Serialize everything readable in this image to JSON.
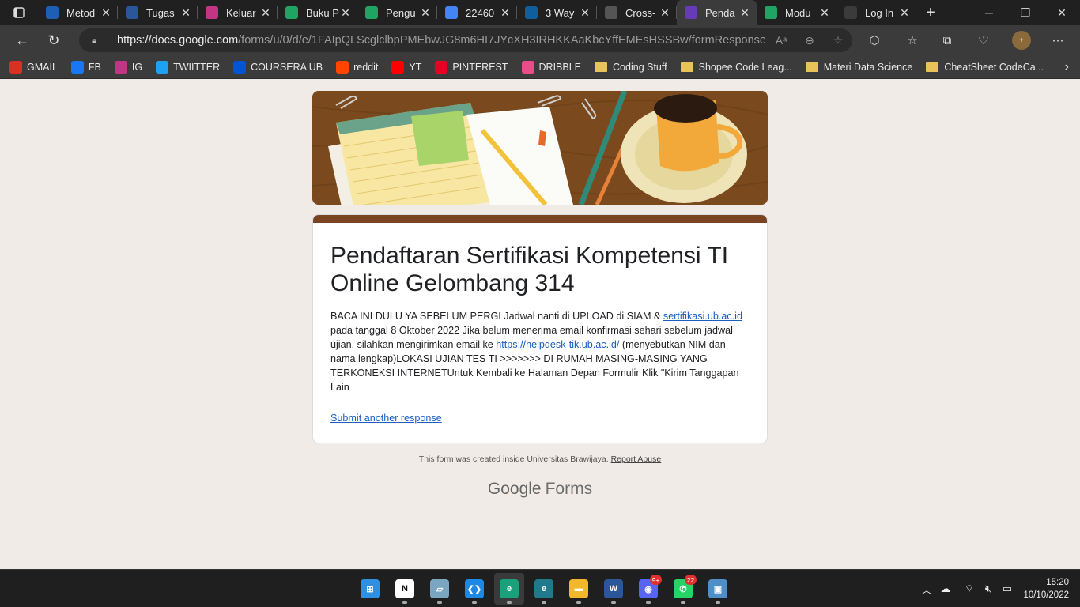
{
  "browser": {
    "tabs": [
      {
        "title": "Metod",
        "icon": "onedrive-icon",
        "color": "#1e5fb4"
      },
      {
        "title": "Tugas",
        "icon": "word-icon",
        "color": "#2b579a"
      },
      {
        "title": "Keluar",
        "icon": "instagram-icon",
        "color": "#c13584"
      },
      {
        "title": "Buku P",
        "icon": "drive-icon",
        "color": "#1fa463"
      },
      {
        "title": "Pengu",
        "icon": "drive-icon",
        "color": "#1fa463"
      },
      {
        "title": "22460",
        "icon": "docs-icon",
        "color": "#4285f4"
      },
      {
        "title": "3 Way",
        "icon": "diamond-icon",
        "color": "#0f5f9e"
      },
      {
        "title": "Cross-",
        "icon": "google-icon",
        "color": "#555555"
      },
      {
        "title": "Penda",
        "icon": "forms-icon",
        "color": "#673ab7",
        "active": true
      },
      {
        "title": "Modu",
        "icon": "drive-icon",
        "color": "#1fa463"
      },
      {
        "title": "Log In",
        "icon": "page-icon",
        "color": "#3b3b3b"
      }
    ],
    "url_host": "https://docs.google.com",
    "url_path": "/forms/u/0/d/e/1FAIpQLScglclbpPMEbwJG8m6HI7JYcXH3IRHKKAaKbcYffEMEsHSSBw/formResponse",
    "avatar": "+"
  },
  "bookmarks": [
    {
      "label": "GMAIL",
      "type": "icon",
      "icon": "gmail-icon",
      "color": "#d93025"
    },
    {
      "label": "FB",
      "type": "icon",
      "icon": "facebook-icon",
      "color": "#1877f2"
    },
    {
      "label": "IG",
      "type": "icon",
      "icon": "instagram-icon",
      "color": "#c13584"
    },
    {
      "label": "TWIITTER",
      "type": "icon",
      "icon": "twitter-icon",
      "color": "#1da1f2"
    },
    {
      "label": "COURSERA UB",
      "type": "icon",
      "icon": "coursera-icon",
      "color": "#0056d2"
    },
    {
      "label": "reddit",
      "type": "icon",
      "icon": "reddit-icon",
      "color": "#ff4500"
    },
    {
      "label": "YT",
      "type": "icon",
      "icon": "youtube-icon",
      "color": "#ff0000"
    },
    {
      "label": "PINTEREST",
      "type": "icon",
      "icon": "pinterest-icon",
      "color": "#e60023"
    },
    {
      "label": "DRIBBLE",
      "type": "icon",
      "icon": "dribbble-icon",
      "color": "#ea4c89"
    },
    {
      "label": "Coding Stuff",
      "type": "folder"
    },
    {
      "label": "Shopee Code Leag...",
      "type": "folder"
    },
    {
      "label": "Materi Data Science",
      "type": "folder"
    },
    {
      "label": "CheatSheet CodeCa...",
      "type": "folder"
    }
  ],
  "form": {
    "title": "Pendaftaran Sertifikasi Kompetensi TI Online Gelombang 314",
    "desc_1": "BACA INI DULU YA SEBELUM PERGI Jadwal nanti di UPLOAD di SIAM & ",
    "link_1": "sertifikasi.ub.ac.id",
    "desc_2": " pada tanggal 8 Oktober  2022 Jika belum menerima email konfirmasi sehari sebelum jadwal ujian, silahkan mengirimkan email ke ",
    "link_2": "https://helpdesk-tik.ub.ac.id/",
    "desc_3": "  (menyebutkan NIM dan nama lengkap)LOKASI UJIAN TES TI >>>>>>>  DI RUMAH MASING-MASING YANG TERKONEKSI INTERNETUntuk Kembali ke Halaman Depan Formulir Klik \"Kirim Tanggapan Lain",
    "submit_another": "Submit another response",
    "accent_color": "#7a4422"
  },
  "footer": {
    "text": "This form was created inside Universitas Brawijaya. ",
    "report": "Report Abuse",
    "brand_google": "Google",
    "brand_forms": "Forms"
  },
  "taskbar": {
    "apps": [
      {
        "name": "windows-start-icon",
        "color": "#2f8fe0",
        "glyph": "⊞"
      },
      {
        "name": "notion-icon",
        "color": "#ffffff",
        "glyph": "N"
      },
      {
        "name": "notes-app-icon",
        "color": "#7aa6c2",
        "glyph": "▱"
      },
      {
        "name": "vscode-icon",
        "color": "#1e88e5",
        "glyph": "❮❯"
      },
      {
        "name": "edge-icon",
        "color": "#1aa07a",
        "glyph": "e",
        "active": true
      },
      {
        "name": "edge-dev-icon",
        "color": "#207a8c",
        "glyph": "e"
      },
      {
        "name": "file-explorer-icon",
        "color": "#f2b82c",
        "glyph": "▬"
      },
      {
        "name": "word-icon",
        "color": "#2b579a",
        "glyph": "W"
      },
      {
        "name": "discord-icon",
        "color": "#5865f2",
        "glyph": "◉",
        "badge": "9+"
      },
      {
        "name": "whatsapp-icon",
        "color": "#25d366",
        "glyph": "✆",
        "badge": "22"
      },
      {
        "name": "photos-icon",
        "color": "#4f8fc8",
        "glyph": "▣"
      }
    ],
    "time": "15:20",
    "date": "10/10/2022"
  }
}
